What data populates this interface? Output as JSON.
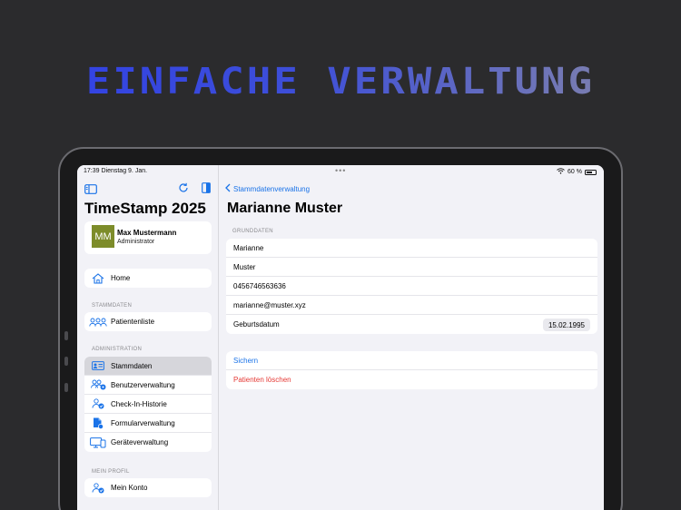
{
  "headline": "EINFACHE VERWALTUNG",
  "status_bar": {
    "time_date": "17:39  Dienstag 9. Jan.",
    "battery": "60 %"
  },
  "app": {
    "title": "TimeStamp 2025"
  },
  "user": {
    "initials": "MM",
    "name": "Max Mustermann",
    "role": "Administrator"
  },
  "sidebar": {
    "home": {
      "label": "Home",
      "icon": "house-icon"
    },
    "stammdaten_section": "STAMMDATEN",
    "stammdaten_items": [
      {
        "label": "Patientenliste",
        "icon": "people-icon"
      }
    ],
    "admin_section": "ADMINISTRATION",
    "admin_items": [
      {
        "label": "Stammdaten",
        "icon": "id-card-icon",
        "selected": true
      },
      {
        "label": "Benutzerverwaltung",
        "icon": "users-gear-icon"
      },
      {
        "label": "Check-In-Historie",
        "icon": "person-check-icon"
      },
      {
        "label": "Formularverwaltung",
        "icon": "document-icon"
      },
      {
        "label": "Geräteverwaltung",
        "icon": "devices-icon"
      }
    ],
    "profile_section": "MEIN PROFIL",
    "profile_items": [
      {
        "label": "Mein Konto",
        "icon": "person-check-icon"
      }
    ]
  },
  "detail": {
    "back_label": "Stammdatenverwaltung",
    "title": "Marianne Muster",
    "group_label": "GRUNDDATEN",
    "fields": {
      "first_name": "Marianne",
      "last_name": "Muster",
      "phone": "0456746563636",
      "email": "marianne@muster.xyz",
      "birthdate_label": "Geburtsdatum",
      "birthdate": "15.02.1995"
    },
    "save_label": "Sichern",
    "delete_label": "Patienten löschen"
  },
  "colors": {
    "accent": "#1a73e8",
    "danger": "#e53935",
    "avatar": "#7d8c2a"
  }
}
